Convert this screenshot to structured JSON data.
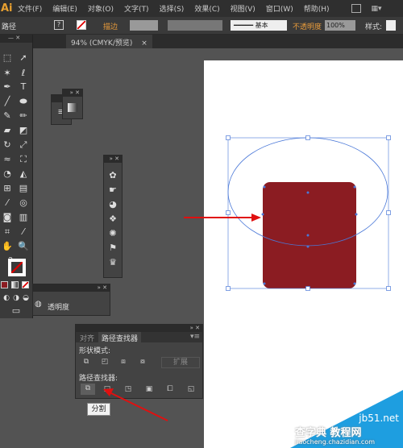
{
  "app": {
    "logo": "Ai"
  },
  "menu": [
    "文件(F)",
    "编辑(E)",
    "对象(O)",
    "文字(T)",
    "选择(S)",
    "效果(C)",
    "视图(V)",
    "窗口(W)",
    "帮助(H)"
  ],
  "control": {
    "object_type": "路径",
    "stroke_label": "描边",
    "stroke_style": "基本",
    "opacity_label": "不透明度",
    "opacity_value": "100%",
    "style_label": "样式:"
  },
  "document_tab": {
    "title": "94% (CMYK/预览)",
    "close": "×"
  },
  "transparency_panel": {
    "label": "透明度"
  },
  "pathfinder_panel": {
    "tabs": [
      "对齐",
      "路径查找器"
    ],
    "active_tab": 1,
    "shape_modes_label": "形状模式:",
    "expand_label": "扩展",
    "pathfinders_label": "路径查找器:",
    "tooltip": "分割"
  },
  "colors": {
    "shape_fill": "#8b1c22",
    "selection": "#4a78d8",
    "arrow": "#e01010",
    "watermark": "#1e9ee0"
  },
  "watermark": {
    "site": "jb51.net",
    "name": "查字典 教程网",
    "url": "jiaocheng.chazidian.com"
  }
}
